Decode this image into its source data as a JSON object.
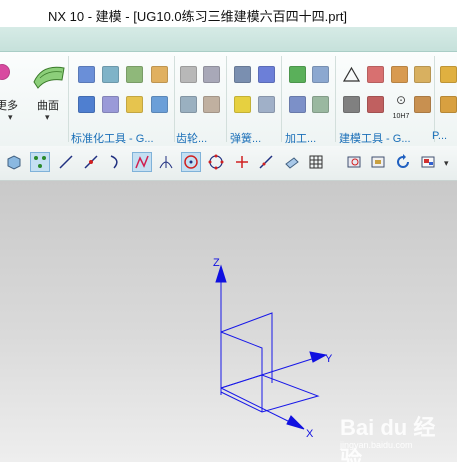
{
  "window": {
    "title": "NX 10 - 建模 - [UG10.0练习三维建模六百四十四.prt]"
  },
  "ribbon": {
    "labels": {
      "more": "更多",
      "surface": "曲面"
    },
    "groups": [
      "标准化工具 - G...",
      "齿轮...",
      "弹簧...",
      "加工...",
      "建模工具 - G...",
      "P..."
    ],
    "badge_10h7": "10H7"
  },
  "viewport": {
    "axes": {
      "z": "Z",
      "y": "Y",
      "x": "X"
    },
    "axis_color": "#1010e0"
  },
  "watermark": {
    "brand": "Bai du 经验",
    "url": "jingyan.baidu.com"
  }
}
